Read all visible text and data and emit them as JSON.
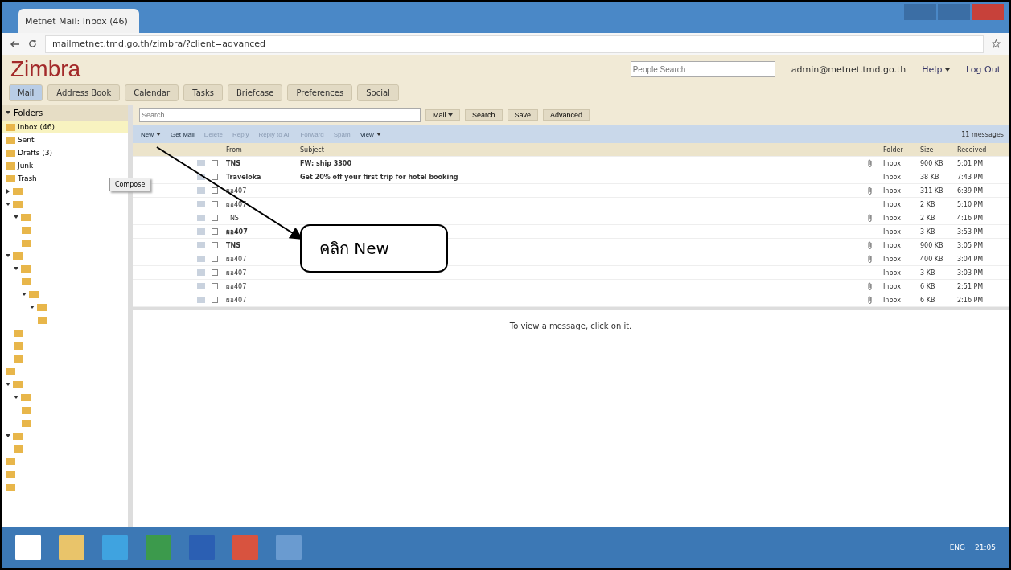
{
  "browser": {
    "tab_title": "Metnet Mail: Inbox (46)",
    "url": "mailmetnet.tmd.go.th/zimbra/?client=advanced"
  },
  "header": {
    "logo": "Zimbra",
    "people_search": {
      "placeholder": "People Search"
    },
    "user": "admin@metnet.tmd.go.th",
    "help": "Help",
    "logout": "Log Out"
  },
  "app_tabs": [
    {
      "label": "Mail",
      "selected": true
    },
    {
      "label": "Address Book",
      "selected": false
    },
    {
      "label": "Calendar",
      "selected": false
    },
    {
      "label": "Tasks",
      "selected": false
    },
    {
      "label": "Briefcase",
      "selected": false
    },
    {
      "label": "Preferences",
      "selected": false
    },
    {
      "label": "Social",
      "selected": false
    }
  ],
  "search": {
    "placeholder": "Search",
    "scope": "Mail",
    "search": "Search",
    "save": "Save",
    "advanced": "Advanced"
  },
  "sidebar": {
    "title": "Folders",
    "folders": [
      {
        "name": "Inbox (46)",
        "selected": true
      },
      {
        "name": "Sent",
        "selected": false
      },
      {
        "name": "Drafts (3)",
        "selected": false
      },
      {
        "name": "Junk",
        "selected": false
      },
      {
        "name": "Trash",
        "selected": false
      },
      {
        "expanded": false,
        "selected": false
      },
      {
        "expanded": true,
        "selected": false,
        "children": [
          {
            "expanded": true,
            "selected": false,
            "children": [
              {
                "selected": false
              },
              {
                "selected": false
              }
            ]
          }
        ]
      },
      {
        "expanded": true,
        "selected": false,
        "children": [
          {
            "expanded": true,
            "selected": false,
            "children": [
              {
                "selected": false
              },
              {
                "expanded": true,
                "selected": false,
                "children": [
                  {
                    "expanded": true,
                    "selected": false,
                    "children": [
                      {
                        "selected": false
                      }
                    ]
                  }
                ]
              }
            ]
          },
          {
            "selected": false
          },
          {
            "selected": false
          },
          {
            "selected": false
          }
        ]
      },
      {
        "selected": false
      },
      {
        "expanded": true,
        "selected": false,
        "children": [
          {
            "expanded": true,
            "selected": false,
            "children": [
              {
                "selected": false
              },
              {
                "selected": false
              }
            ]
          }
        ]
      },
      {
        "expanded": true,
        "selected": false,
        "children": [
          {
            "selected": false
          }
        ]
      },
      {
        "selected": false
      },
      {
        "selected": false
      },
      {
        "selected": false
      }
    ]
  },
  "tooltip": "Compose",
  "toolbar": {
    "new": "New",
    "buttons": [
      "Get Mail",
      "Delete",
      "Reply",
      "Reply to All",
      "Forward",
      "Spam"
    ],
    "view": "View",
    "count": "11 messages"
  },
  "columns": [
    "From",
    "Subject",
    "Folder",
    "Size",
    "Received"
  ],
  "rows": [
    {
      "from": "TNS",
      "subject": "FW: ship 3300",
      "attachment": true,
      "folder": "Inbox",
      "size": "900 KB",
      "received": "5:01 PM",
      "unread": true,
      "checked": false
    },
    {
      "from": "Traveloka",
      "subject": "Get 20% off your first trip for hotel booking",
      "attachment": false,
      "folder": "Inbox",
      "size": "38 KB",
      "received": "7:43 PM",
      "unread": true,
      "checked": false
    },
    {
      "from": "ผอ407",
      "subject": "",
      "attachment": true,
      "folder": "Inbox",
      "size": "311 KB",
      "received": "6:39 PM",
      "unread": false,
      "checked": false
    },
    {
      "from": "ผอ407",
      "subject": "",
      "attachment": false,
      "folder": "Inbox",
      "size": "2 KB",
      "received": "5:10 PM",
      "unread": false,
      "checked": false
    },
    {
      "from": "TNS",
      "subject": "",
      "attachment": true,
      "folder": "Inbox",
      "size": "2 KB",
      "received": "4:16 PM",
      "unread": false,
      "checked": false
    },
    {
      "from": "ผอ407",
      "subject": "",
      "attachment": false,
      "folder": "Inbox",
      "size": "3 KB",
      "received": "3:53 PM",
      "unread": true,
      "checked": false
    },
    {
      "from": "TNS",
      "subject": "",
      "attachment": true,
      "folder": "Inbox",
      "size": "900 KB",
      "received": "3:05 PM",
      "unread": true,
      "checked": false
    },
    {
      "from": "ผอ407",
      "subject": "",
      "attachment": true,
      "folder": "Inbox",
      "size": "400 KB",
      "received": "3:04 PM",
      "unread": false,
      "checked": false
    },
    {
      "from": "ผอ407",
      "subject": "",
      "attachment": false,
      "folder": "Inbox",
      "size": "3 KB",
      "received": "3:03 PM",
      "unread": false,
      "checked": false
    },
    {
      "from": "ผอ407",
      "subject": "",
      "attachment": true,
      "folder": "Inbox",
      "size": "6 KB",
      "received": "2:51 PM",
      "unread": false,
      "checked": false
    },
    {
      "from": "ผอ407",
      "subject": "",
      "attachment": true,
      "folder": "Inbox",
      "size": "6 KB",
      "received": "2:16 PM",
      "unread": false,
      "checked": false
    }
  ],
  "reading_pane": "To view a message, click on it.",
  "callout": "คลิก New",
  "taskbar": {
    "language": "ENG",
    "time": "21:05"
  }
}
